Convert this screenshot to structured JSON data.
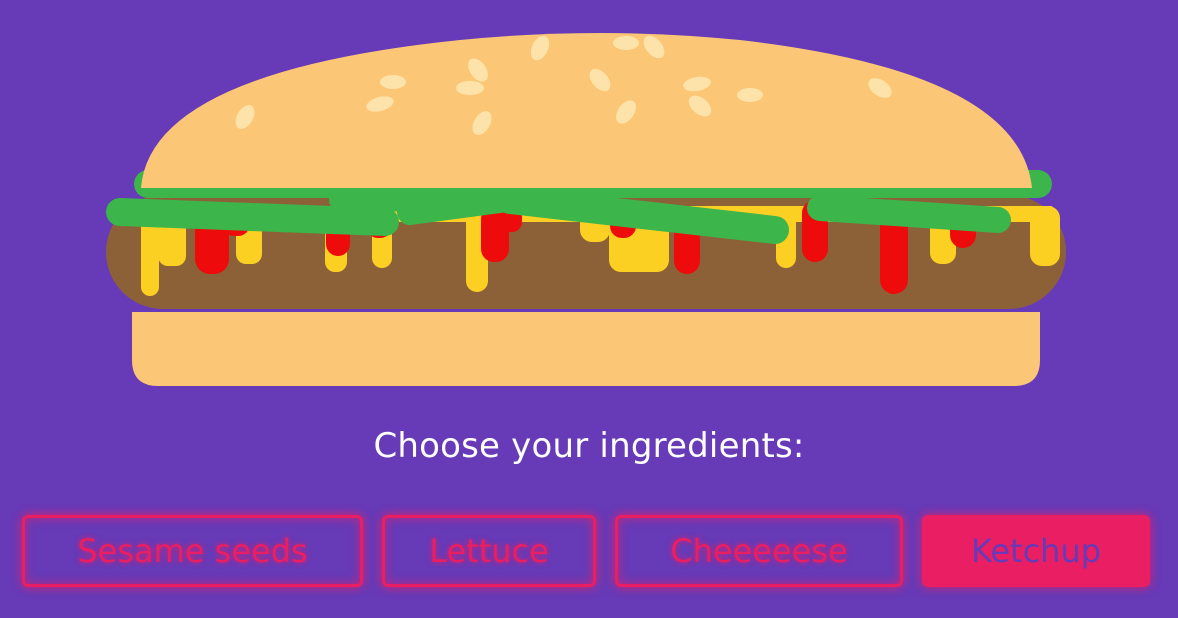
{
  "prompt": "Choose your ingredients:",
  "ingredients": [
    {
      "label": "Sesame seeds",
      "active": false
    },
    {
      "label": "Lettuce",
      "active": false
    },
    {
      "label": "Cheeeeese",
      "active": false
    },
    {
      "label": "Ketchup",
      "active": true
    }
  ],
  "colors": {
    "background": "#673ab7",
    "bun": "#fbc676",
    "seed": "#fde3aa",
    "patty": "#8d6138",
    "cheese": "#fbd022",
    "ketchup": "#ee0b0b",
    "lettuce": "#3cb54a",
    "accent": "#e91e63"
  }
}
